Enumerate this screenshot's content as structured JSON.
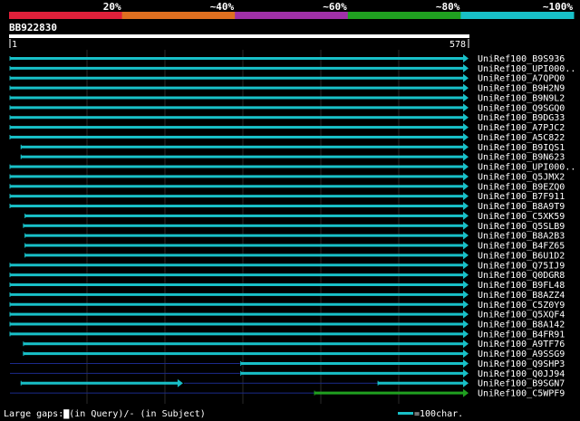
{
  "chart_data": {
    "type": "blast-alignment-overview",
    "identity_scale": [
      {
        "label": "20%",
        "color": "#e0203a"
      },
      {
        "label": "~40%",
        "color": "#e07020"
      },
      {
        "label": "~60%",
        "color": "#a030a8"
      },
      {
        "label": "~80%",
        "color": "#20a020"
      },
      {
        "label": "~100%",
        "color": "#18c0c8"
      }
    ],
    "query_name": "BB922830",
    "query_range": [
      1,
      578
    ],
    "ruler": {
      "start_label": "1",
      "end_label": "578"
    },
    "hits": [
      {
        "name": "UniRef100_B9S936",
        "start": 1,
        "end": 578,
        "identity_color": "#18c0c8",
        "gap_before": null
      },
      {
        "name": "UniRef100_UPI000..",
        "start": 1,
        "end": 578,
        "identity_color": "#18c0c8",
        "gap_before": null
      },
      {
        "name": "UniRef100_A7QPQ0",
        "start": 1,
        "end": 578,
        "identity_color": "#18c0c8",
        "gap_before": null
      },
      {
        "name": "UniRef100_B9H2N9",
        "start": 1,
        "end": 578,
        "identity_color": "#18c0c8",
        "gap_before": null
      },
      {
        "name": "UniRef100_B9N9L2",
        "start": 1,
        "end": 578,
        "identity_color": "#18c0c8",
        "gap_before": null
      },
      {
        "name": "UniRef100_Q9SGQ0",
        "start": 1,
        "end": 578,
        "identity_color": "#18c0c8",
        "gap_before": null
      },
      {
        "name": "UniRef100_B9DG33",
        "start": 1,
        "end": 578,
        "identity_color": "#18c0c8",
        "gap_before": null
      },
      {
        "name": "UniRef100_A7PJC2",
        "start": 1,
        "end": 578,
        "identity_color": "#18c0c8",
        "gap_before": null
      },
      {
        "name": "UniRef100_A5C822",
        "start": 1,
        "end": 578,
        "identity_color": "#18c0c8",
        "gap_before": null
      },
      {
        "name": "UniRef100_B9IQS1",
        "start": 15,
        "end": 578,
        "identity_color": "#18c0c8",
        "gap_before": null
      },
      {
        "name": "UniRef100_B9N623",
        "start": 15,
        "end": 578,
        "identity_color": "#18c0c8",
        "gap_before": null
      },
      {
        "name": "UniRef100_UPI000..",
        "start": 1,
        "end": 578,
        "identity_color": "#18c0c8",
        "gap_before": null
      },
      {
        "name": "UniRef100_Q5JMX2",
        "start": 1,
        "end": 578,
        "identity_color": "#18c0c8",
        "gap_before": null
      },
      {
        "name": "UniRef100_B9EZQ0",
        "start": 1,
        "end": 578,
        "identity_color": "#18c0c8",
        "gap_before": null
      },
      {
        "name": "UniRef100_B7F911",
        "start": 1,
        "end": 578,
        "identity_color": "#18c0c8",
        "gap_before": null
      },
      {
        "name": "UniRef100_B8A9T9",
        "start": 1,
        "end": 578,
        "identity_color": "#18c0c8",
        "gap_before": null
      },
      {
        "name": "UniRef100_C5XK59",
        "start": 20,
        "end": 578,
        "identity_color": "#18c0c8",
        "gap_before": null
      },
      {
        "name": "UniRef100_Q5SLB9",
        "start": 18,
        "end": 578,
        "identity_color": "#18c0c8",
        "gap_before": null
      },
      {
        "name": "UniRef100_B8A2B3",
        "start": 20,
        "end": 578,
        "identity_color": "#18c0c8",
        "gap_before": null
      },
      {
        "name": "UniRef100_B4FZ65",
        "start": 20,
        "end": 578,
        "identity_color": "#18c0c8",
        "gap_before": null
      },
      {
        "name": "UniRef100_B6U1D2",
        "start": 20,
        "end": 578,
        "identity_color": "#18c0c8",
        "gap_before": null
      },
      {
        "name": "UniRef100_Q75IJ9",
        "start": 1,
        "end": 578,
        "identity_color": "#18c0c8",
        "gap_before": null
      },
      {
        "name": "UniRef100_Q0DGR8",
        "start": 1,
        "end": 578,
        "identity_color": "#18c0c8",
        "gap_before": null
      },
      {
        "name": "UniRef100_B9FL48",
        "start": 1,
        "end": 578,
        "identity_color": "#18c0c8",
        "gap_before": null
      },
      {
        "name": "UniRef100_B8AZZ4",
        "start": 1,
        "end": 578,
        "identity_color": "#18c0c8",
        "gap_before": null
      },
      {
        "name": "UniRef100_C5Z0Y9",
        "start": 1,
        "end": 578,
        "identity_color": "#18c0c8",
        "gap_before": null
      },
      {
        "name": "UniRef100_Q5XQF4",
        "start": 1,
        "end": 578,
        "identity_color": "#18c0c8",
        "gap_before": null
      },
      {
        "name": "UniRef100_B8A142",
        "start": 1,
        "end": 578,
        "identity_color": "#18c0c8",
        "gap_before": null
      },
      {
        "name": "UniRef100_B4FR91",
        "start": 1,
        "end": 578,
        "identity_color": "#18c0c8",
        "gap_before": null
      },
      {
        "name": "UniRef100_A9TF76",
        "start": 18,
        "end": 578,
        "identity_color": "#18c0c8",
        "gap_before": null
      },
      {
        "name": "UniRef100_A9SSG9",
        "start": 18,
        "end": 578,
        "identity_color": "#18c0c8",
        "gap_before": null
      },
      {
        "name": "UniRef100_Q9SHP3",
        "start": 292,
        "end": 578,
        "identity_color": "#18c0c8",
        "gap_before": [
          1,
          291
        ]
      },
      {
        "name": "UniRef100_Q0JJ94",
        "start": 292,
        "end": 578,
        "identity_color": "#18c0c8",
        "gap_before": [
          1,
          291
        ]
      },
      {
        "name": "UniRef100_B9SGN7",
        "start": 15,
        "end": 218,
        "identity_color": "#18c0c8",
        "gap_before": null,
        "extra": [
          {
            "start": 465,
            "end": 578,
            "identity_color": "#18c0c8"
          }
        ],
        "gap_between": [
          218,
          465
        ]
      },
      {
        "name": "UniRef100_C5WPF9",
        "start": 385,
        "end": 578,
        "identity_color": "#20a020",
        "gap_before": [
          1,
          385
        ]
      }
    ],
    "footer": {
      "legend_text": "Large gaps:▇(in Query)/- (in Subject)",
      "scale_label": "=100char."
    }
  }
}
